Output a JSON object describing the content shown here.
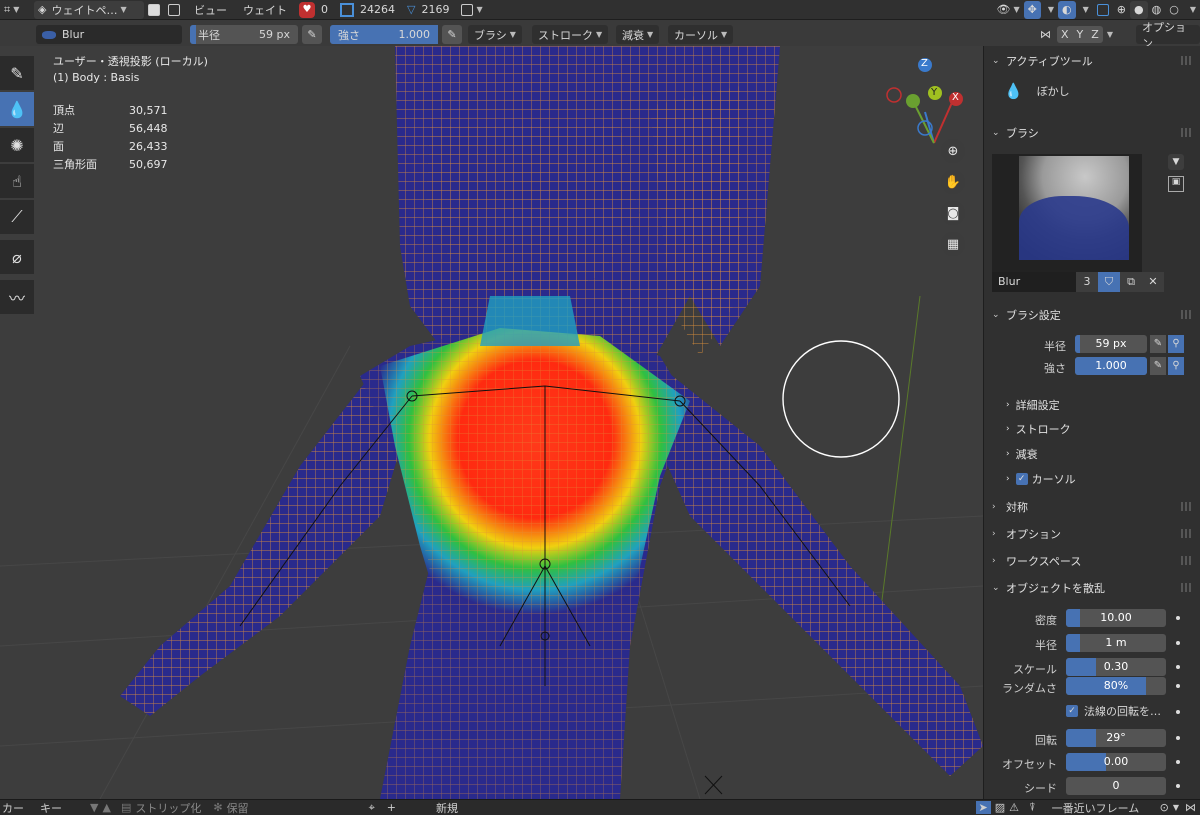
{
  "header": {
    "mode_label": "ウェイトペ…",
    "menu_view": "ビュー",
    "menu_weight": "ウェイト",
    "bone_count": "0",
    "vert_count": "24264",
    "face_count": "2169"
  },
  "tool_settings": {
    "brush_name": "Blur",
    "radius_label": "半径",
    "radius_value": "59 px",
    "strength_label": "強さ",
    "strength_value": "1.000",
    "menu_brush": "ブラシ",
    "menu_stroke": "ストローク",
    "menu_falloff": "減衰",
    "menu_cursor": "カーソル",
    "axis_x": "X",
    "axis_y": "Y",
    "axis_z": "Z",
    "options": "オプション"
  },
  "viewport": {
    "view_name": "ユーザー・透視投影 (ローカル)",
    "object_name": "(1) Body : Basis",
    "stats": [
      {
        "label": "頂点",
        "value": "30,571"
      },
      {
        "label": "辺",
        "value": "56,448"
      },
      {
        "label": "面",
        "value": "26,433"
      },
      {
        "label": "三角形面",
        "value": "50,697"
      }
    ],
    "gizmo": {
      "x": "X",
      "y": "Y",
      "z": "Z"
    }
  },
  "panel": {
    "active_tool_header": "アクティブツール",
    "active_tool_name": "ぼかし",
    "brush_header": "ブラシ",
    "brush_name": "Blur",
    "brush_users": "3",
    "brush_settings_header": "ブラシ設定",
    "radius_label": "半径",
    "radius_value": "59 px",
    "strength_label": "強さ",
    "strength_value": "1.000",
    "sub_advanced": "詳細設定",
    "sub_stroke": "ストローク",
    "sub_falloff": "減衰",
    "sub_cursor": "カーソル",
    "symmetry": "対称",
    "options": "オプション",
    "workspace": "ワークスペース",
    "scatter_header": "オブジェクトを散乱",
    "density_label": "密度",
    "density_value": "10.00",
    "scatter_radius_label": "半径",
    "scatter_radius_value": "1 m",
    "scale_label": "スケール",
    "scale_value": "0.30",
    "random_label": "ランダムさ",
    "random_value": "80%",
    "random_fill": 0.8,
    "normal_rot_label": "法線の回転を…",
    "rotation_label": "回転",
    "rotation_value": "29°",
    "offset_label": "オフセット",
    "offset_value": "0.00",
    "seed_label": "シード",
    "seed_value": "0"
  },
  "footer": {
    "left1": "カー",
    "left2": "キー",
    "strip": "ストリップ化",
    "keep": "保留",
    "new": "新規",
    "nearest_frame": "一番近いフレーム"
  },
  "colors": {
    "accent": "#4772b3",
    "mesh_blue": "#2a2a8c",
    "wire": "#e0913a"
  }
}
